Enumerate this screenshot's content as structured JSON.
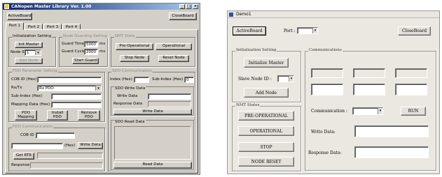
{
  "left_window": {
    "title": "CANopen Master Library Ver. 1.00",
    "active_board_label": "ActiveBoard",
    "close_board_label": "CloseBoard",
    "tabs": [
      {
        "label": "Port 1",
        "active": true
      },
      {
        "label": "Port 2",
        "active": false
      },
      {
        "label": "Port 3",
        "active": false
      },
      {
        "label": "Port 4",
        "active": false
      }
    ],
    "init": {
      "title": "Initialization Setting",
      "init_master_label": "Init Master",
      "node_id_label": "Node ID",
      "node_id_value": "1",
      "add_node_label": "Add Node"
    },
    "node_guarding": {
      "title": "Node Guarding Setting",
      "guard_time_label": "Guard Time",
      "guard_time_value": "5000",
      "guard_time_unit": "ms",
      "guard_cycle_label": "Guard Cycle",
      "guard_cycle_value": "2000",
      "guard_cycle_unit": "ms",
      "start_guard_label": "Start Guard"
    },
    "nmt_state": {
      "title": "NMT State",
      "pre_operational_label": "Pre-Operational",
      "operational_label": "Operational",
      "stop_node_label": "Stop Node",
      "reset_node_label": "Reset Node"
    },
    "pdo_param": {
      "title": "PDO Parameter Setting",
      "cob_id_label": "COB ID (Hex)",
      "rx_tx_label": "Rx/Tx",
      "rx_tx_value": "Rx PDO",
      "sub_index_label": "Sub-Index (Hex)",
      "mapping_data_label": "Mapping Data (Hex)",
      "pdo_mapping_label": "PDO Mapping",
      "install_pdo_label": "Install PDO",
      "remove_pdo_label": "Remove PDO"
    },
    "sdo_comm": {
      "title": "SDO Communication",
      "index_label": "Index (Hex)",
      "sub_index_label": "Sub-Index (Hex)",
      "sub_index_value": "0",
      "sdo_write_data_title": "SDO Write Data",
      "write_data_label": "Write Data",
      "response_data_label": "Response Data",
      "write_data_button": "Write Data",
      "sdo_read_data_title": "SDO Read Data",
      "read_data_button": "Read Data"
    },
    "pdo_comm": {
      "title": "PDO Communication",
      "cob_id_label": "COB ID",
      "hex_label": "(Hex)",
      "write_data_button": "Write Data",
      "get_rtr_label": "Get RTR",
      "response_label": "Response"
    }
  },
  "right_window": {
    "title": "Demo1",
    "active_board_label": "ActiveBoard",
    "port_label": "Port :",
    "close_board_label": "CloseBoard",
    "init": {
      "title": "Initialization Setting",
      "initialize_master_label": "Initialize Master",
      "slave_node_id_label": "Slave Node ID :",
      "add_node_label": "Add Node"
    },
    "communications": {
      "title": "Communications",
      "communication_label": "Communication :",
      "run_label": "RUN",
      "write_data_label": "Write Data:",
      "response_data_label": "Response Data:"
    },
    "nmt_states": {
      "title": "NMT States",
      "pre_operational_label": "PRE-OPERATIONAL",
      "operational_label": "OPERATIONAL",
      "stop_label": "STOP",
      "node_reset_label": "NODE RESET"
    }
  }
}
